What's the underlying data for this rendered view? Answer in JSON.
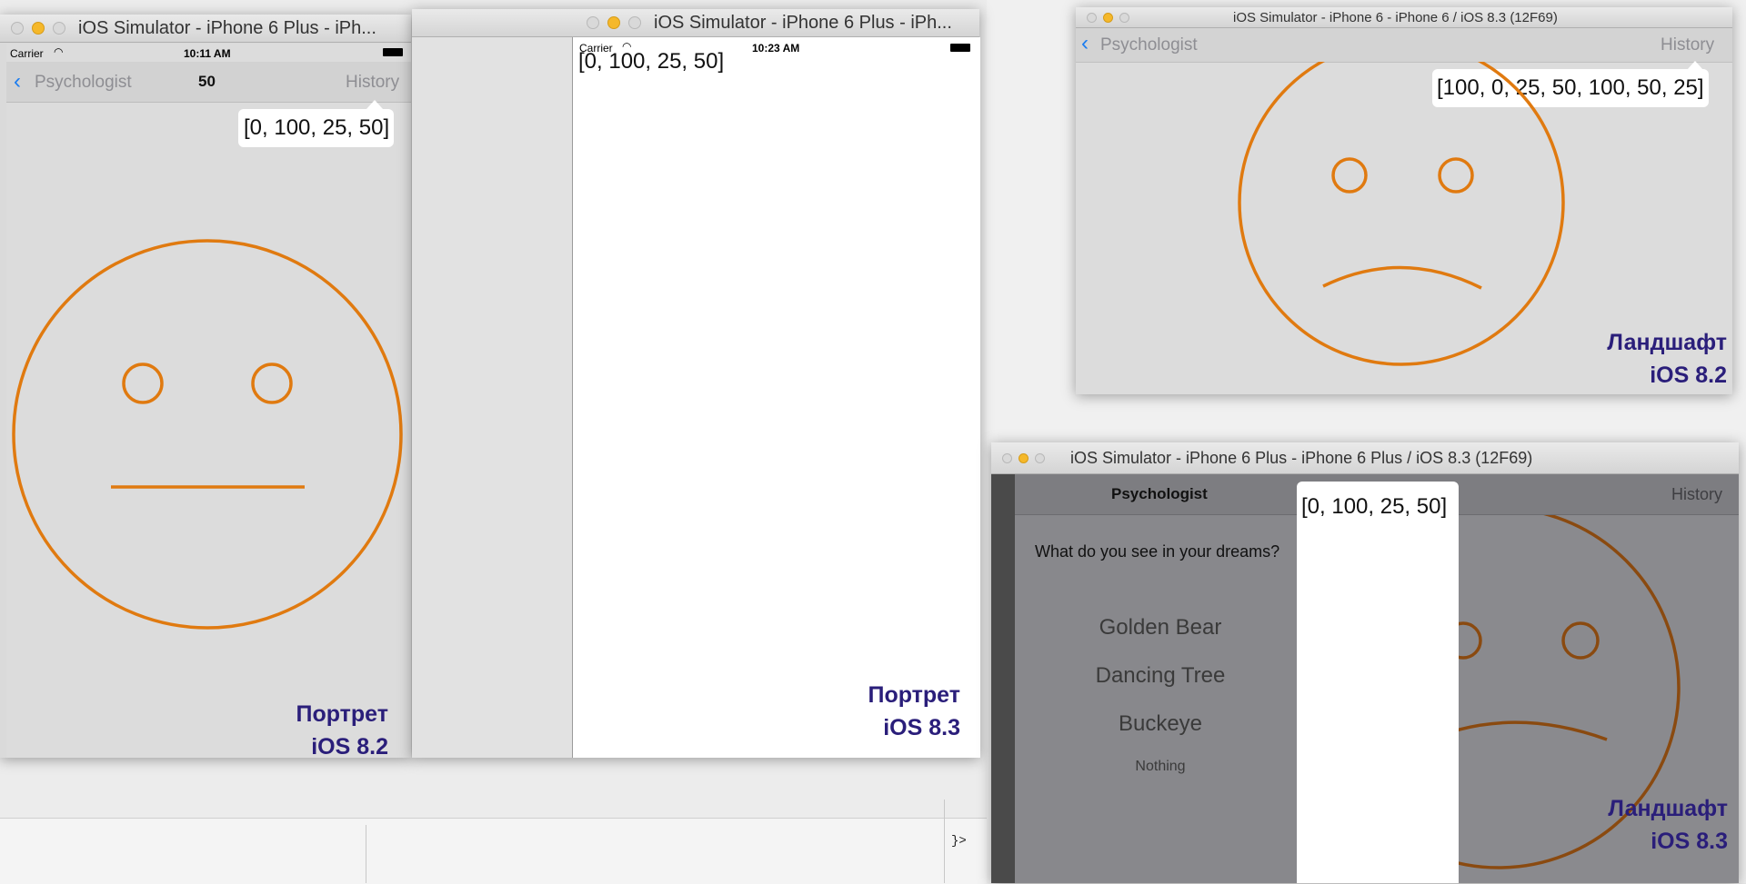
{
  "palette": {
    "face_stroke": "#e07a10",
    "caption_color": "#2a1e7a",
    "ios_blue": "#1a7cf0",
    "ios_gray": "#8e8e93"
  },
  "win1": {
    "title": "iOS Simulator - iPhone 6 Plus - iPh...",
    "status": {
      "carrier": "Carrier",
      "time": "10:11 AM"
    },
    "nav": {
      "back": "Psychologist",
      "title": "50",
      "right": "History"
    },
    "popover": "[0, 100, 25, 50]",
    "face": {
      "mood": "neutral"
    },
    "caption": {
      "line1": "Портрет",
      "line2": "iOS 8.2"
    }
  },
  "win2": {
    "title": "iOS Simulator - iPhone 6 Plus - iPh...",
    "status": {
      "carrier": "Carrier",
      "time": "10:23 AM"
    },
    "text": "[0, 100, 25, 50]",
    "caption": {
      "line1": "Портрет",
      "line2": "iOS 8.3"
    }
  },
  "win3": {
    "title": "iOS Simulator - iPhone 6 - iPhone 6 / iOS 8.3 (12F69)",
    "nav": {
      "back": "Psychologist",
      "right": "History"
    },
    "popover": "[100, 0, 25, 50, 100, 50, 25]",
    "face": {
      "mood": "sad"
    },
    "caption": {
      "line1": "Ландшафт",
      "line2": "iOS 8.2"
    }
  },
  "win4": {
    "title": "iOS Simulator - iPhone 6 Plus - iPhone 6 Plus / iOS 8.3 (12F69)",
    "nav": {
      "title": "Psychologist",
      "right": "History"
    },
    "question": "What do you see in your dreams?",
    "options": [
      "Golden Bear",
      "Dancing Tree",
      "Buckeye",
      "Nothing"
    ],
    "popover": "[0, 100, 25, 50]",
    "face": {
      "mood": "sad"
    },
    "caption": {
      "line1": "Ландшафт",
      "line2": "iOS 8.3"
    }
  },
  "background": {
    "code_fragment": "}>"
  }
}
